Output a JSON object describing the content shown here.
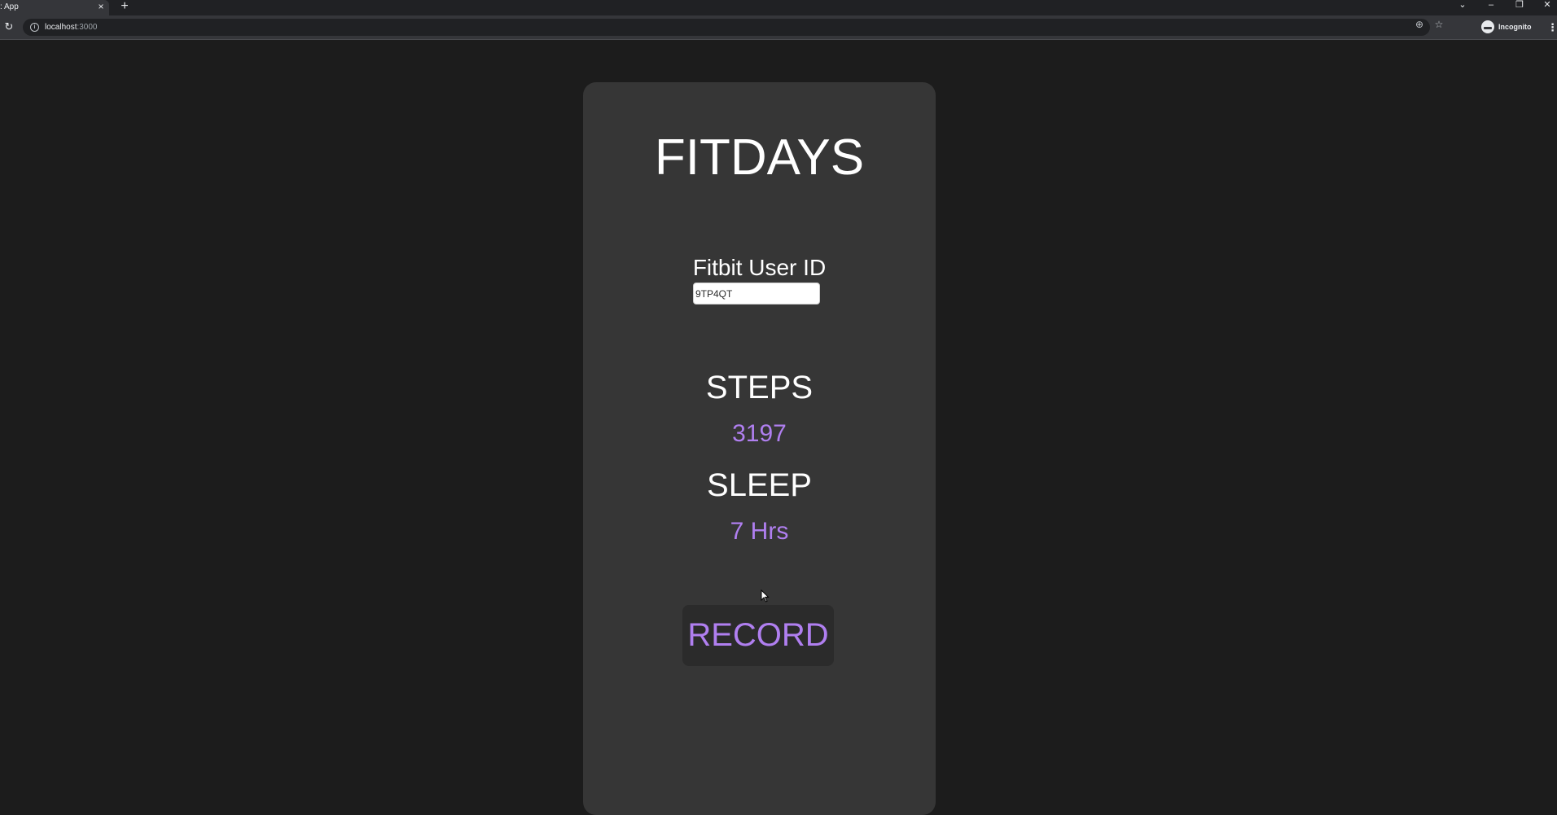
{
  "browser": {
    "tab_title": ": App",
    "tab_close_icon": "×",
    "new_tab_icon": "+",
    "window_controls": {
      "tab_search_icon": "⌄",
      "minimize_icon": "–",
      "restore_icon": "❐",
      "close_icon": "✕"
    },
    "reload_icon": "↻",
    "info_icon": "i",
    "url_host": "localhost",
    "url_port": ":3000",
    "zoom_icon": "⊕",
    "star_icon": "☆",
    "profile_label": "Incognito",
    "menu_icon": "⋮"
  },
  "app": {
    "title": "FITDAYS",
    "user_id_label": "Fitbit User ID",
    "user_id_value": "9TP4QT",
    "steps_heading": "STEPS",
    "steps_value": "3197",
    "sleep_heading": "SLEEP",
    "sleep_value": "7 Hrs",
    "record_label": "RECORD"
  },
  "colors": {
    "page_background": "#1c1c1c",
    "card_background": "#363636",
    "accent": "#b07ff0",
    "heading_text": "#ffffff",
    "button_background": "#2b2b2b"
  }
}
